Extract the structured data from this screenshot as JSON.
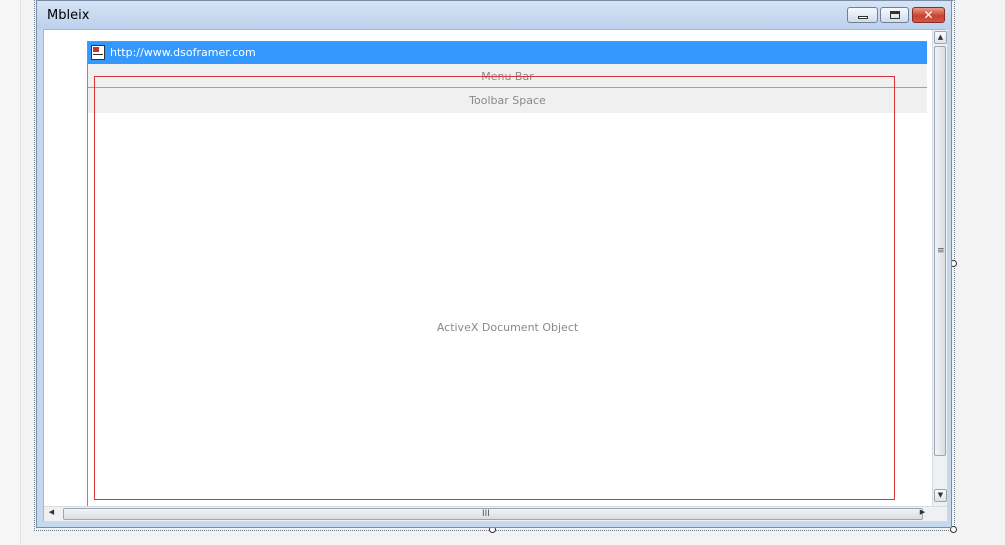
{
  "window": {
    "title": "Mbleix"
  },
  "window_buttons": {
    "minimize_icon": "minimize-icon",
    "maximize_icon": "maximize-icon",
    "close_icon": "close-icon"
  },
  "control": {
    "url": "http://www.dsoframer.com",
    "menu_bar_label": "Menu Bar",
    "toolbar_label": "Toolbar Space",
    "document_label": "ActiveX Document Object"
  },
  "colors": {
    "url_bar": "#3399ff",
    "selection_rect": "#d9343c",
    "close_button": "#c8432e"
  },
  "scrollbar_grips": {
    "vertical": "≡",
    "horizontal": "III"
  }
}
